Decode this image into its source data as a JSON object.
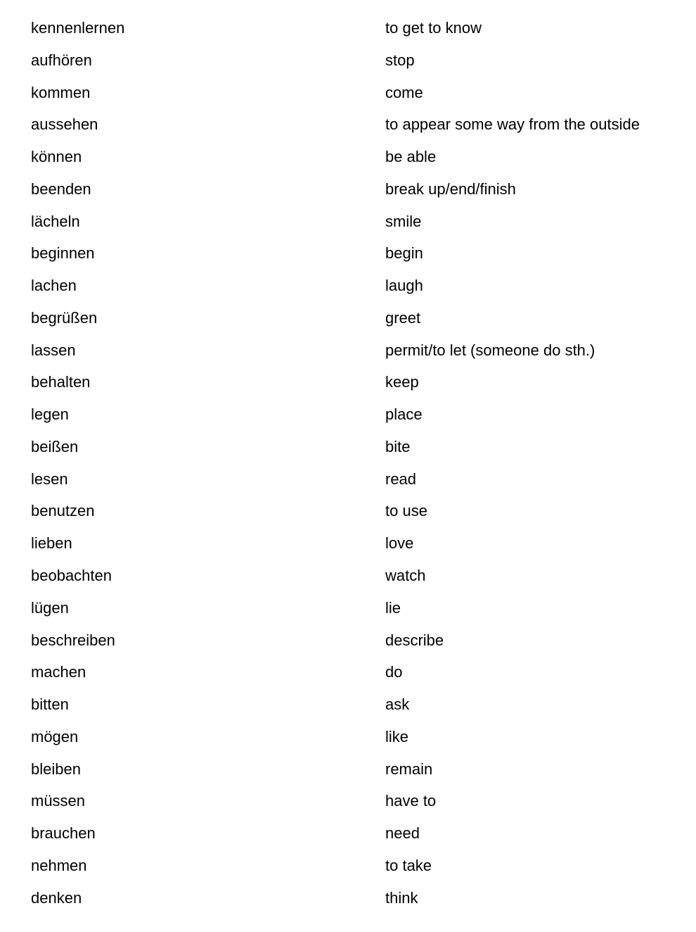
{
  "vocabulary": [
    {
      "german": "kennenlernen",
      "english": "to get to know"
    },
    {
      "german": "aufhören",
      "english": "stop"
    },
    {
      "german": "kommen",
      "english": "come"
    },
    {
      "german": "aussehen",
      "english": "to appear some way from the outside"
    },
    {
      "german": "können",
      "english": "be able"
    },
    {
      "german": "beenden",
      "english": "break up/end/finish"
    },
    {
      "german": "lächeln",
      "english": "smile"
    },
    {
      "german": "beginnen",
      "english": "begin"
    },
    {
      "german": "lachen",
      "english": "laugh"
    },
    {
      "german": "begrüßen",
      "english": "greet"
    },
    {
      "german": "lassen",
      "english": "permit/to let (someone do sth.)"
    },
    {
      "german": "behalten",
      "english": "keep"
    },
    {
      "german": "legen",
      "english": "place"
    },
    {
      "german": "beißen",
      "english": "bite"
    },
    {
      "german": "lesen",
      "english": "read"
    },
    {
      "german": "benutzen",
      "english": "to use"
    },
    {
      "german": "lieben",
      "english": "love"
    },
    {
      "german": "beobachten",
      "english": "watch"
    },
    {
      "german": "lügen",
      "english": "lie"
    },
    {
      "german": "beschreiben",
      "english": "describe"
    },
    {
      "german": "machen",
      "english": "do"
    },
    {
      "german": "bitten",
      "english": "ask"
    },
    {
      "german": "mögen",
      "english": "like"
    },
    {
      "german": "bleiben",
      "english": "remain"
    },
    {
      "german": "müssen",
      "english": "have to"
    },
    {
      "german": "brauchen",
      "english": "need"
    },
    {
      "german": "nehmen",
      "english": "to take"
    },
    {
      "german": "denken",
      "english": "think"
    }
  ]
}
